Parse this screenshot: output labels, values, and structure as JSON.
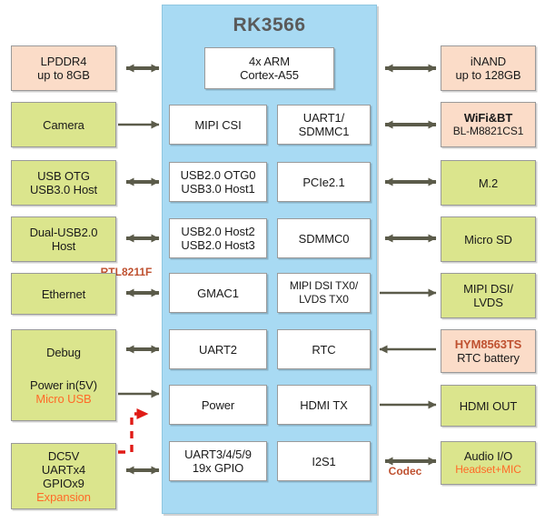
{
  "diagram": {
    "soc": {
      "title": "RK3566",
      "cpu": {
        "lines": [
          "4x ARM",
          "Cortex-A55"
        ]
      }
    },
    "soc_left_blocks": [
      {
        "lines": [
          "MIPI CSI"
        ]
      },
      {
        "lines": [
          "USB2.0 OTG0",
          "USB3.0 Host1"
        ]
      },
      {
        "lines": [
          "USB2.0 Host2",
          "USB2.0 Host3"
        ]
      },
      {
        "lines": [
          "GMAC1"
        ]
      },
      {
        "lines": [
          "UART2"
        ]
      },
      {
        "lines": [
          "Power"
        ]
      },
      {
        "lines": [
          "UART3/4/5/9",
          "19x GPIO"
        ]
      }
    ],
    "soc_right_blocks": [
      {
        "lines": [
          "UART1/",
          "SDMMC1"
        ]
      },
      {
        "lines": [
          "PCIe2.1"
        ]
      },
      {
        "lines": [
          "SDMMC0"
        ]
      },
      {
        "lines": [
          "MIPI DSI TX0/",
          "LVDS TX0"
        ]
      },
      {
        "lines": [
          "RTC"
        ]
      },
      {
        "lines": [
          "HDMI TX"
        ]
      },
      {
        "lines": [
          "I2S1"
        ]
      }
    ],
    "left_blocks": [
      {
        "lines": [
          {
            "t": "LPDDR4"
          },
          {
            "t": "up to 8GB"
          }
        ],
        "color": "peach"
      },
      {
        "lines": [
          {
            "t": "Camera"
          }
        ],
        "color": "green"
      },
      {
        "lines": [
          {
            "t": "USB OTG"
          },
          {
            "t": "USB3.0 Host"
          }
        ],
        "color": "green"
      },
      {
        "lines": [
          {
            "t": "Dual-USB2.0"
          },
          {
            "t": "Host"
          }
        ],
        "color": "green"
      },
      {
        "lines": [
          {
            "t": "Ethernet"
          }
        ],
        "color": "green"
      },
      {
        "lines": [
          {
            "t": "Debug"
          }
        ],
        "color": "green"
      },
      {
        "lines": [
          {
            "t": "Power in(5V)"
          },
          {
            "t": "Micro USB",
            "style": "orange"
          }
        ],
        "color": "green"
      },
      {
        "lines": [
          {
            "t": "DC5V"
          },
          {
            "t": "UARTx4"
          },
          {
            "t": "GPIOx9"
          },
          {
            "t": "Expansion",
            "style": "orange"
          }
        ],
        "color": "green"
      }
    ],
    "right_blocks": [
      {
        "lines": [
          {
            "t": "iNAND"
          },
          {
            "t": "up to 128GB"
          }
        ],
        "color": "peach"
      },
      {
        "lines": [
          {
            "t": "WiFi&BT",
            "style": "bold"
          },
          {
            "t": "BL-M8821CS1"
          }
        ],
        "color": "peach"
      },
      {
        "lines": [
          {
            "t": "M.2"
          }
        ],
        "color": "green"
      },
      {
        "lines": [
          {
            "t": "Micro SD"
          }
        ],
        "color": "green"
      },
      {
        "lines": [
          {
            "t": "MIPI DSI/"
          },
          {
            "t": "LVDS"
          }
        ],
        "color": "green"
      },
      {
        "lines": [
          {
            "t": "HYM8563TS",
            "style": "rust"
          },
          {
            "t": "RTC battery"
          }
        ],
        "color": "peach"
      },
      {
        "lines": [
          {
            "t": "HDMI OUT"
          }
        ],
        "color": "green"
      },
      {
        "lines": [
          {
            "t": "Audio I/O"
          },
          {
            "t": "Headset+MIC",
            "style": "orange"
          }
        ],
        "color": "green"
      }
    ],
    "connector_labels": [
      {
        "text": "RTL8211F"
      },
      {
        "text": "Codec"
      }
    ],
    "colors": {
      "soc_fill": "#a8daf3",
      "peach_fill": "#fbdcc8",
      "green_fill": "#dbe58d",
      "block_fill": "#ffffff",
      "arrow": "#5b5b4a",
      "power_arrow": "#e01b16",
      "rust_text": "#bf5130",
      "orange_text": "#ff6a28",
      "title_text": "#5a5a5a"
    }
  }
}
